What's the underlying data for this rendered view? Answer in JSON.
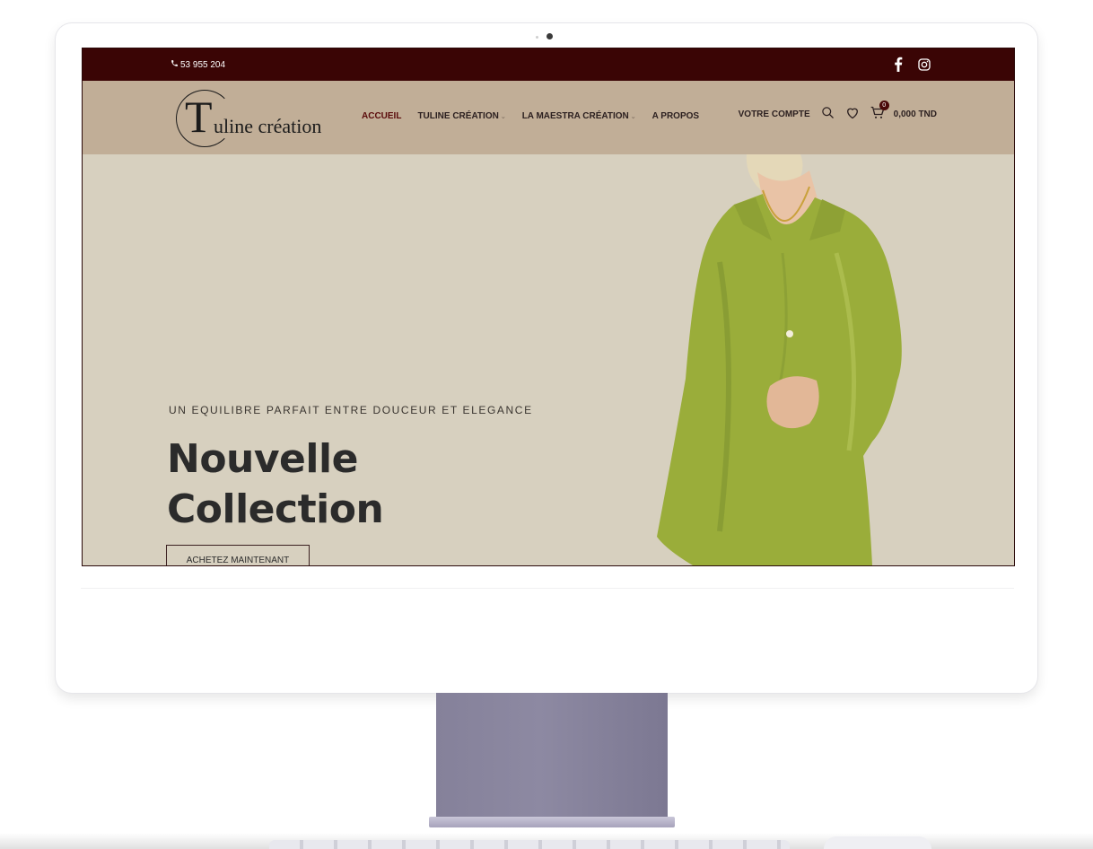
{
  "topbar": {
    "phone": "53 955 204",
    "social_icons": [
      "facebook-icon",
      "instagram-icon"
    ]
  },
  "header": {
    "logo_initial": "T",
    "logo_rest": "uline création",
    "nav": [
      {
        "label": "ACCUEIL",
        "active": true,
        "has_dropdown": false
      },
      {
        "label": "TULINE CRÉATION",
        "active": false,
        "has_dropdown": true
      },
      {
        "label": "LA MAESTRA CRÉATION",
        "active": false,
        "has_dropdown": true
      },
      {
        "label": "A PROPOS",
        "active": false,
        "has_dropdown": false
      }
    ],
    "account_label": "VOTRE COMPTE",
    "cart_count": "0",
    "cart_total": "0,000 TND"
  },
  "hero": {
    "subtitle": "UN EQUILIBRE PARFAIT ENTRE DOUCEUR ET ELEGANCE",
    "title_line1": "Nouvelle",
    "title_line2": "Collection",
    "cta_label": "ACHETEZ MAINTENANT"
  },
  "colors": {
    "topbar_bg": "#3a0505",
    "header_bg": "#c1ae97",
    "hero_bg": "#d7d0bf",
    "active_nav": "#5a0b0b",
    "garment": "#9aad3a"
  }
}
